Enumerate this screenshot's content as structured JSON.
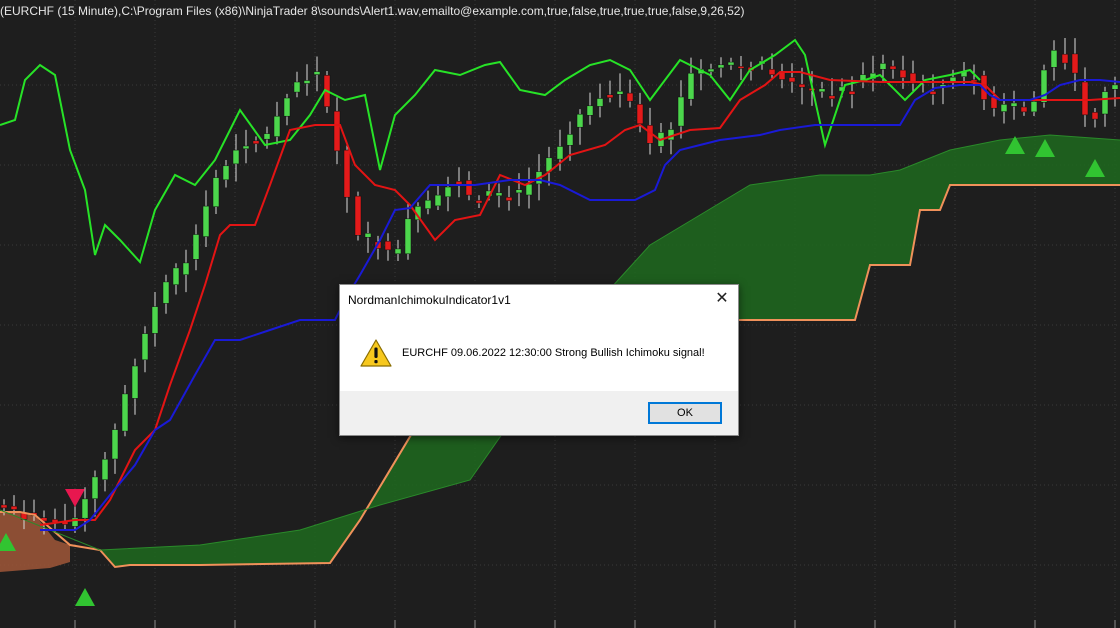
{
  "chart": {
    "title": "(EURCHF (15 Minute),C:\\Program Files (x86)\\NinjaTrader 8\\sounds\\Alert1.wav,emailto@example.com,true,false,true,true,true,false,9,26,52)",
    "background": "#1e1e1e",
    "colors": {
      "bull_candle": "#4cd64c",
      "bear_candle": "#e41a1a",
      "wick": "#d9d9d9",
      "chikou_span": "#27e327",
      "tenkan_sen": "#e31414",
      "kijun_sen": "#1a1ad6",
      "senkou_span_b": "#f0915a",
      "bullish_cloud": "#1f6a1f",
      "bearish_cloud": "#a85a3a",
      "buy_signal": "#31c431",
      "sell_signal": "#e8174f",
      "grid": "#3a3a3a"
    },
    "signals": [
      {
        "type": "buy",
        "icon": "buy-signal-triangle-icon"
      },
      {
        "type": "sell",
        "icon": "sell-signal-triangle-icon"
      },
      {
        "type": "buy",
        "icon": "buy-signal-triangle-icon"
      },
      {
        "type": "buy",
        "icon": "buy-signal-triangle-icon"
      },
      {
        "type": "buy",
        "icon": "buy-signal-triangle-icon"
      },
      {
        "type": "buy",
        "icon": "buy-signal-triangle-icon"
      }
    ]
  },
  "dialog": {
    "title": "NordmanIchimokuIndicator1v1",
    "message": "EURCHF 09.06.2022 12:30:00 Strong Bullish Ichimoku signal!",
    "ok_label": "OK",
    "close_symbol": "✕",
    "icon": "warning-icon"
  }
}
